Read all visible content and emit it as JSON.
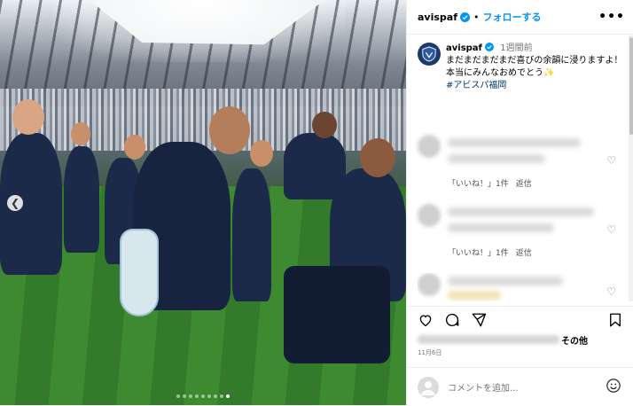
{
  "header": {
    "username": "avispaf",
    "separator": "•",
    "follow_label": "フォローする",
    "more_label": "•••"
  },
  "caption": {
    "username": "avispaf",
    "time": "1週間前",
    "line1": "まだまだまだまだ喜びの余韻に浸りますよ！",
    "line2": "本当にみんなおめでとう✨",
    "hashtag": "#アビスパ福岡"
  },
  "comments": [
    {
      "likes_label": "「いいね！」1件",
      "reply_label": "返信"
    },
    {
      "likes_label": "「いいね！」1件",
      "reply_label": "返信"
    },
    {
      "likes_label": "",
      "reply_label": ""
    }
  ],
  "likes": {
    "suffix": "その他"
  },
  "post_date": "11月6日",
  "add_comment": {
    "placeholder": "コメントを追加..."
  },
  "carousel": {
    "slide_count": 9,
    "active_index": 8
  },
  "colors": {
    "accent": "#0095f6",
    "hashtag": "#00376b",
    "muted": "#737373",
    "team_navy": "#1c2a4a"
  }
}
